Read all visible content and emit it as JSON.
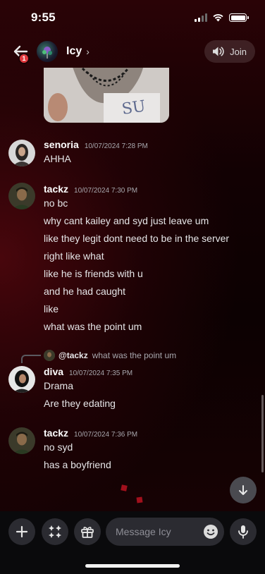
{
  "status_bar": {
    "time": "9:55"
  },
  "header": {
    "badge_count": "1",
    "channel_name": "Icy",
    "join_label": "Join"
  },
  "messages": [
    {
      "username": "senoria",
      "timestamp": "10/07/2024 7:28 PM",
      "lines": [
        "AHHA"
      ]
    },
    {
      "username": "tackz",
      "timestamp": "10/07/2024 7:30 PM",
      "lines": [
        "no bc",
        "why cant kailey and syd just leave um",
        "like they legit dont need to be in the server",
        "right like what",
        "like he is friends with u",
        "and he had caught",
        "like",
        "what was the point um"
      ]
    },
    {
      "reply_to": {
        "username": "@tackz",
        "text": "what was the point um"
      },
      "username": "diva",
      "timestamp": "10/07/2024 7:35 PM",
      "lines": [
        "Drama",
        "Are they edating"
      ]
    },
    {
      "username": "tackz",
      "timestamp": "10/07/2024 7:36 PM",
      "lines": [
        "no syd",
        "has a boyfriend"
      ]
    }
  ],
  "composer": {
    "placeholder": "Message Icy"
  },
  "colors": {
    "accent_red": "#e03a3e",
    "background": "#0c0102",
    "input_bg": "#2b2b31"
  }
}
